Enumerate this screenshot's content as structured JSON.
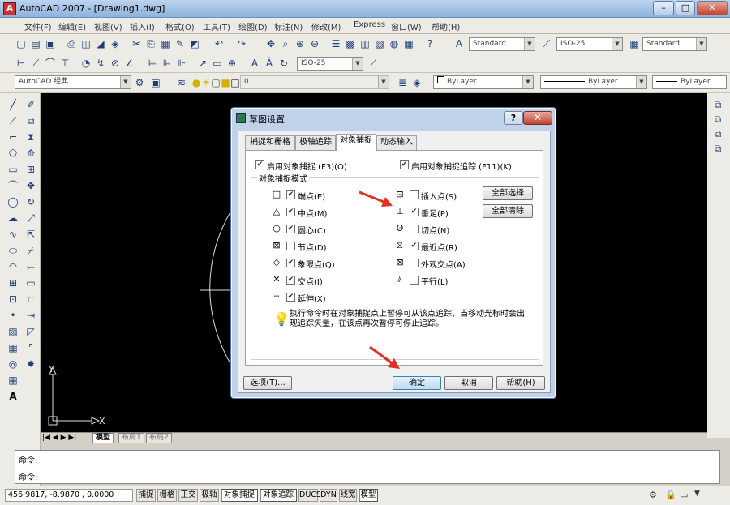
{
  "window": {
    "title": "AutoCAD 2007 - [Drawing1.dwg]",
    "minimize": "–",
    "restore": "□",
    "close": "✕"
  },
  "menubar": {
    "items": [
      "文件(F)",
      "编辑(E)",
      "视图(V)",
      "插入(I)",
      "格式(O)",
      "工具(T)",
      "绘图(D)",
      "标注(N)",
      "修改(M)",
      "Express",
      "窗口(W)",
      "帮助(H)"
    ]
  },
  "toolbar": {
    "text_style": "Standard",
    "dim_style": "ISO-25",
    "table_style": "Standard",
    "dim_style2": "ISO-25",
    "workspace": "AutoCAD 经典",
    "layer": "0",
    "color": "ByLayer",
    "linetype": "ByLayer",
    "lineweight": "ByLayer"
  },
  "layout_tabs": [
    "模型",
    "布局1",
    "布局2"
  ],
  "canvas": {
    "ucs_x": "X",
    "ucs_y": "Y"
  },
  "command": {
    "line1": "命令:",
    "line2": "命令:"
  },
  "status": {
    "coords": "456.9817, -8.9870 , 0.0000",
    "buttons": [
      {
        "label": "捕捉",
        "on": false
      },
      {
        "label": "栅格",
        "on": false
      },
      {
        "label": "正交",
        "on": false
      },
      {
        "label": "极轴",
        "on": false
      },
      {
        "label": "对象捕捉",
        "on": true
      },
      {
        "label": "对象追踪",
        "on": true
      },
      {
        "label": "DUCS",
        "on": false
      },
      {
        "label": "DYN",
        "on": false
      },
      {
        "label": "线宽",
        "on": false
      },
      {
        "label": "模型",
        "on": true
      }
    ]
  },
  "dialog": {
    "title": "草图设置",
    "help_button": "?",
    "close_button": "✕",
    "tabs": [
      "捕捉和栅格",
      "极轴追踪",
      "对象捕捉",
      "动态输入"
    ],
    "active_tab": "对象捕捉",
    "enable_osnap": {
      "label": "启用对象捕捉 (F3)(O)",
      "checked": true
    },
    "enable_otrack": {
      "label": "启用对象捕捉追踪 (F11)(K)",
      "checked": true
    },
    "group_title": "对象捕捉模式",
    "modes_left": [
      {
        "symbol": "□",
        "label": "端点(E)",
        "checked": true
      },
      {
        "symbol": "△",
        "label": "中点(M)",
        "checked": true
      },
      {
        "symbol": "○",
        "label": "圆心(C)",
        "checked": true
      },
      {
        "symbol": "⊠",
        "label": "节点(D)",
        "checked": false
      },
      {
        "symbol": "◇",
        "label": "象限点(Q)",
        "checked": true
      },
      {
        "symbol": "✕",
        "label": "交点(I)",
        "checked": true
      },
      {
        "symbol": "┄",
        "label": "延伸(X)",
        "checked": true
      }
    ],
    "modes_right": [
      {
        "symbol": "⊡",
        "label": "插入点(S)",
        "checked": false
      },
      {
        "symbol": "⊥",
        "label": "垂足(P)",
        "checked": true
      },
      {
        "symbol": "ʘ",
        "label": "切点(N)",
        "checked": false
      },
      {
        "symbol": "⧖",
        "label": "最近点(R)",
        "checked": true
      },
      {
        "symbol": "⊠",
        "label": "外观交点(A)",
        "checked": false
      },
      {
        "symbol": "⫽",
        "label": "平行(L)",
        "checked": false
      }
    ],
    "select_all": "全部选择",
    "clear_all": "全部清除",
    "note": "执行命令时在对象捕捉点上暂停可从该点追踪，当移动光标时会出现追踪矢量，在该点再次暂停可停止追踪。",
    "options": "选项(T)...",
    "ok": "确定",
    "cancel": "取消",
    "help": "帮助(H)"
  },
  "colors": {
    "annotation_arrow": "#e03020",
    "canvas": "#000000"
  }
}
